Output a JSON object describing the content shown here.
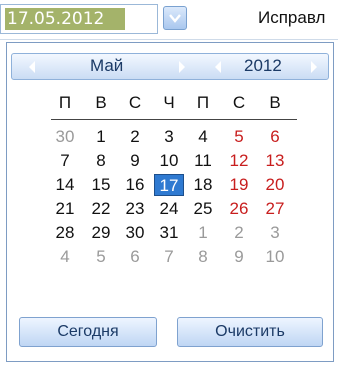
{
  "date_field": {
    "value": "17.05.2012"
  },
  "side_label": "Исправл",
  "calendar": {
    "month": "Май",
    "year": "2012",
    "weekdays": [
      "П",
      "В",
      "С",
      "Ч",
      "П",
      "С",
      "В"
    ],
    "weeks": [
      [
        "30",
        "1",
        "2",
        "3",
        "4",
        "5",
        "6"
      ],
      [
        "7",
        "8",
        "9",
        "10",
        "11",
        "12",
        "13"
      ],
      [
        "14",
        "15",
        "16",
        "17",
        "18",
        "19",
        "20"
      ],
      [
        "21",
        "22",
        "23",
        "24",
        "25",
        "26",
        "27"
      ],
      [
        "28",
        "29",
        "30",
        "31",
        "1",
        "2",
        "3"
      ],
      [
        "4",
        "5",
        "6",
        "7",
        "8",
        "9",
        "10"
      ]
    ],
    "selected_day": "17",
    "buttons": {
      "today": "Сегодня",
      "clear": "Очистить"
    }
  },
  "colors": {
    "selected_bg": "#2f7ad1",
    "weekend": "#c81e1e",
    "other_month": "#9a9a9a",
    "field_highlight": "#a4b36a"
  },
  "icons": {
    "dropdown": "chevron-down-icon",
    "prev_month": "arrow-left-icon",
    "next_month": "arrow-right-icon",
    "prev_year": "arrow-left-icon",
    "next_year": "arrow-right-icon"
  }
}
